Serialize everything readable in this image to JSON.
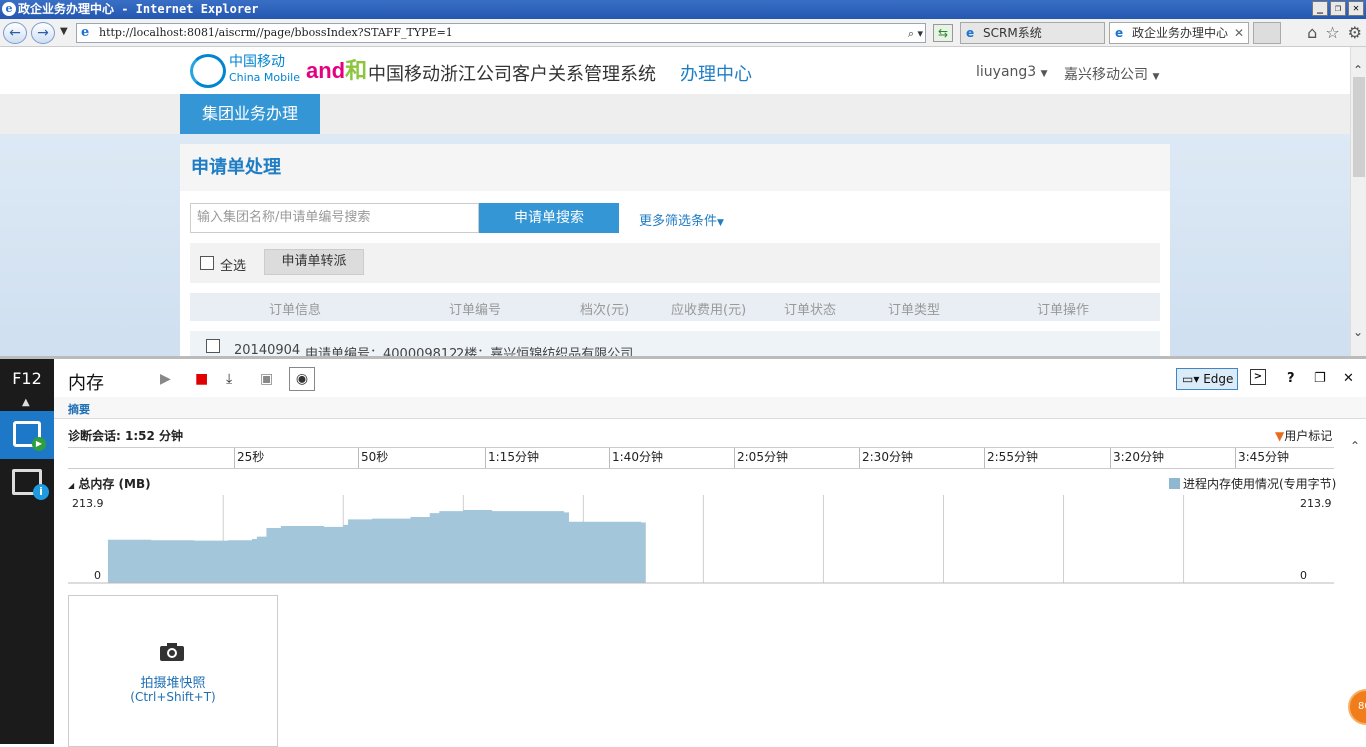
{
  "browser": {
    "title": "政企业务办理中心 - Internet Explorer",
    "url": "http://localhost:8081/aiscrm//page/bbossIndex?STAFF_TYPE=1",
    "tabs": [
      {
        "label": "SCRM系统",
        "active": false
      },
      {
        "label": "政企业务办理中心",
        "active": true
      }
    ]
  },
  "header": {
    "logo_cn": "中国移动",
    "logo_en": "China Mobile",
    "brand_and": "and",
    "brand_he": "和",
    "system_title": "中国移动浙江公司客户关系管理系统",
    "center": "办理中心",
    "user": "liuyang3",
    "company": "嘉兴移动公司"
  },
  "nav": {
    "active_tab": "集团业务办理"
  },
  "panel": {
    "title": "申请单处理",
    "search_placeholder": "输入集团名称/申请单编号搜索",
    "search_button": "申请单搜索",
    "more_filters": "更多筛选条件",
    "select_all": "全选",
    "transfer_button": "申请单转派",
    "columns": [
      "订单信息",
      "订单编号",
      "档次(元)",
      "应收费用(元)",
      "订单状态",
      "订单类型",
      "订单操作"
    ],
    "first_row": {
      "date": "20140904",
      "apply_no": "申请单编号：400009812",
      "company": "2楼：嘉兴恒锦纺织品有限公司"
    }
  },
  "devtools": {
    "f12": "F12",
    "title": "内存",
    "edge_mode": "Edge",
    "summary_tab": "摘要",
    "session": "诊断会话: 1:52 分钟",
    "user_mark": "用户标记",
    "ruler_ticks": [
      "25秒",
      "50秒",
      "1:15分钟",
      "1:40分钟",
      "2:05分钟",
      "2:30分钟",
      "2:55分钟",
      "3:20分钟",
      "3:45分钟"
    ],
    "total_memory_label": "总内存 (MB)",
    "legend": "进程内存使用情况(专用字节)",
    "y_max": "213.9",
    "y_min": "0",
    "snapshot_label": "拍摄堆快照",
    "snapshot_keys": "(Ctrl+Shift+T)",
    "badge": "80"
  },
  "chart_data": {
    "type": "area",
    "ylabel": "总内存 (MB)",
    "ylim": [
      0,
      213.9
    ],
    "x_unit": "seconds",
    "xlim": [
      0,
      247
    ],
    "series": [
      {
        "name": "进程内存使用情况(专用字节)",
        "points": [
          [
            0,
            110
          ],
          [
            9,
            109
          ],
          [
            18,
            108
          ],
          [
            25,
            109
          ],
          [
            30,
            112
          ],
          [
            31,
            118
          ],
          [
            33,
            140
          ],
          [
            36,
            145
          ],
          [
            45,
            143
          ],
          [
            49,
            148
          ],
          [
            50,
            162
          ],
          [
            55,
            164
          ],
          [
            63,
            168
          ],
          [
            67,
            178
          ],
          [
            69,
            183
          ],
          [
            74,
            186
          ],
          [
            80,
            183
          ],
          [
            95,
            180
          ],
          [
            96,
            156
          ],
          [
            111,
            154
          ],
          [
            112,
            154
          ]
        ]
      }
    ],
    "grid": true,
    "legend_position": "top-right"
  }
}
